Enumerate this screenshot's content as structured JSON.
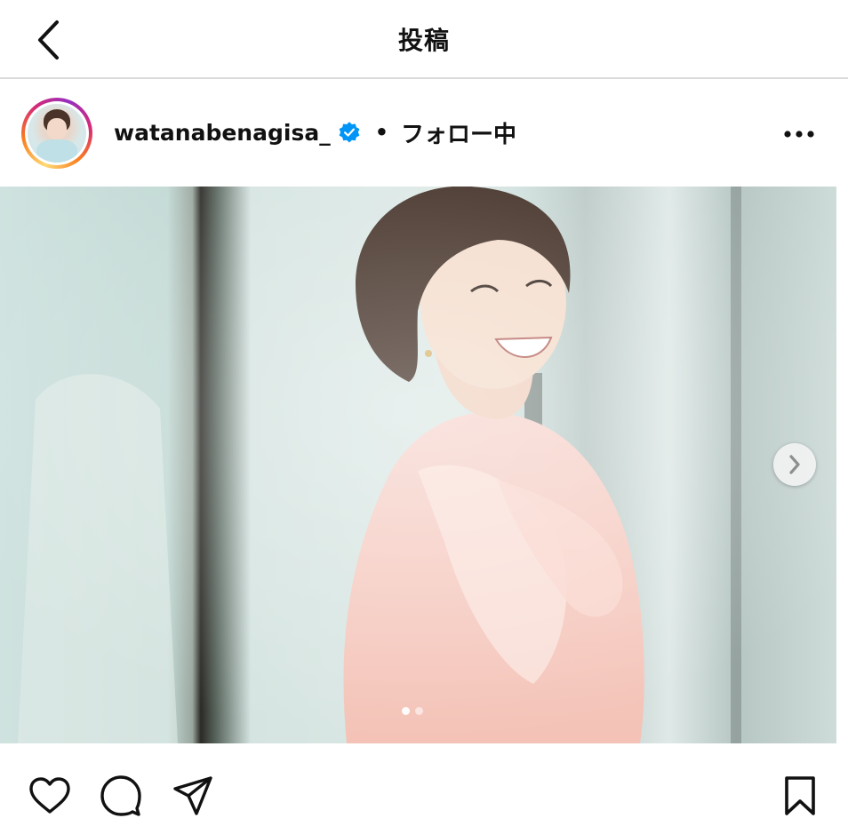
{
  "header": {
    "title": "投稿",
    "back_icon": "chevron-left-icon"
  },
  "post": {
    "username": "watanabenagisa_",
    "verified_icon": "verified-badge-icon",
    "separator": "•",
    "follow_status": "フォロー中",
    "more_icon": "more-horizontal-icon"
  },
  "media": {
    "next_icon": "chevron-right-icon",
    "carousel": {
      "count": 2,
      "active_index": 0
    }
  },
  "actions": {
    "like_icon": "heart-icon",
    "comment_icon": "comment-icon",
    "share_icon": "paper-plane-icon",
    "save_icon": "bookmark-icon"
  },
  "colors": {
    "verified": "#0095f6",
    "divider": "#dbdbdb",
    "text": "#111111"
  }
}
